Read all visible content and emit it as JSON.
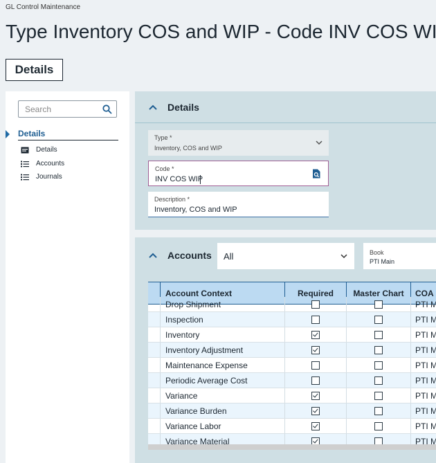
{
  "breadcrumb": "GL Control Maintenance",
  "page_title": "Type Inventory COS and WIP - Code INV COS WIP",
  "header_button": "Details",
  "sidebar": {
    "search_placeholder": "Search",
    "section": "Details",
    "items": [
      {
        "label": "Details",
        "icon": "details-card-icon"
      },
      {
        "label": "Accounts",
        "icon": "list-icon"
      },
      {
        "label": "Journals",
        "icon": "list-icon"
      }
    ]
  },
  "details_panel": {
    "title": "Details",
    "type_label": "Type *",
    "type_value": "Inventory, COS and WIP",
    "code_label": "Code *",
    "code_value": "INV COS WIP",
    "description_label": "Description *",
    "description_value": "Inventory, COS and WIP"
  },
  "accounts_panel": {
    "title": "Accounts",
    "filter_value": "All",
    "book_label": "Book",
    "book_value": "PTI Main",
    "columns": [
      "Account Context",
      "Required",
      "Master Chart",
      "COA M"
    ],
    "rows": [
      {
        "context": "Drop Shipment",
        "required": false,
        "master": false,
        "coa": "PTI Ma"
      },
      {
        "context": "Inspection",
        "required": false,
        "master": false,
        "coa": "PTI Ma"
      },
      {
        "context": "Inventory",
        "required": true,
        "master": false,
        "coa": "PTI Ma"
      },
      {
        "context": "Inventory Adjustment",
        "required": true,
        "master": false,
        "coa": "PTI Ma"
      },
      {
        "context": "Maintenance Expense",
        "required": false,
        "master": false,
        "coa": "PTI Ma"
      },
      {
        "context": "Periodic Average Cost",
        "required": false,
        "master": false,
        "coa": "PTI Ma"
      },
      {
        "context": "Variance",
        "required": true,
        "master": false,
        "coa": "PTI Ma"
      },
      {
        "context": "Variance Burden",
        "required": true,
        "master": false,
        "coa": "PTI Ma"
      },
      {
        "context": "Variance Labor",
        "required": true,
        "master": false,
        "coa": "PTI Ma"
      },
      {
        "context": "Variance Material",
        "required": true,
        "master": false,
        "coa": "PTI Ma"
      }
    ]
  },
  "colors": {
    "accent": "#1f5e92",
    "panel": "#cfdfe4",
    "header_row": "#bcdaf2",
    "focus_border": "#a05e94"
  }
}
